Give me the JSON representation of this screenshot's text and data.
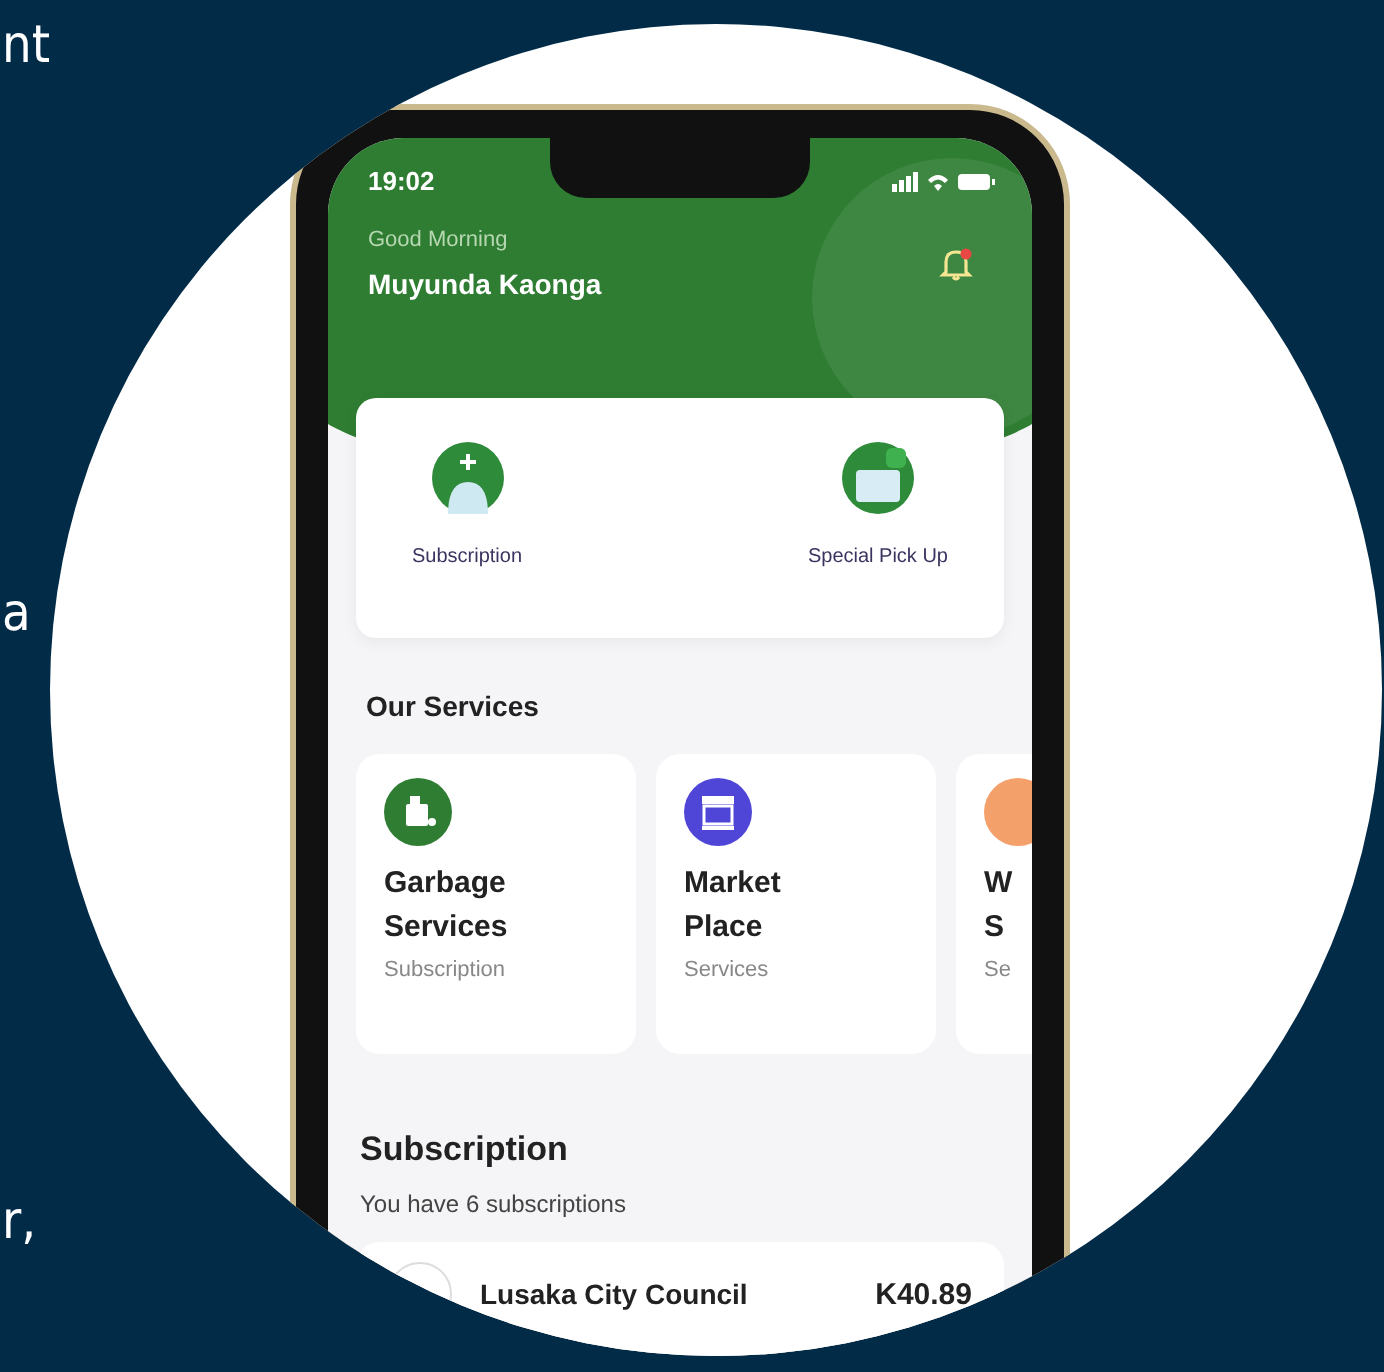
{
  "side_text": [
    "nt",
    "a",
    "r,"
  ],
  "status_bar": {
    "time": "19:02"
  },
  "header": {
    "greeting": "Good Morning",
    "name": "Muyunda Kaonga",
    "notification": true
  },
  "quick_actions": [
    {
      "label": "Subscription",
      "kind": "add"
    },
    {
      "label": "Special Pick Up",
      "kind": "pickup"
    }
  ],
  "services": {
    "title": "Our Services",
    "items": [
      {
        "title_lines": [
          "Garbage",
          "Services"
        ],
        "subtitle": "Subscription",
        "color": "#2e7d32",
        "kind": "garbage"
      },
      {
        "title_lines": [
          "Market",
          "Place"
        ],
        "subtitle": "Services",
        "color": "#4f46d8",
        "kind": "market"
      },
      {
        "title_lines": [
          "W",
          "S"
        ],
        "subtitle": "Se",
        "color": "#f4a06b",
        "kind": "other"
      }
    ]
  },
  "subscription": {
    "title": "Subscription",
    "subtitle": "You have 6 subscriptions",
    "rows": [
      {
        "name": "Lusaka City Council",
        "amount": "K40.89"
      }
    ]
  }
}
